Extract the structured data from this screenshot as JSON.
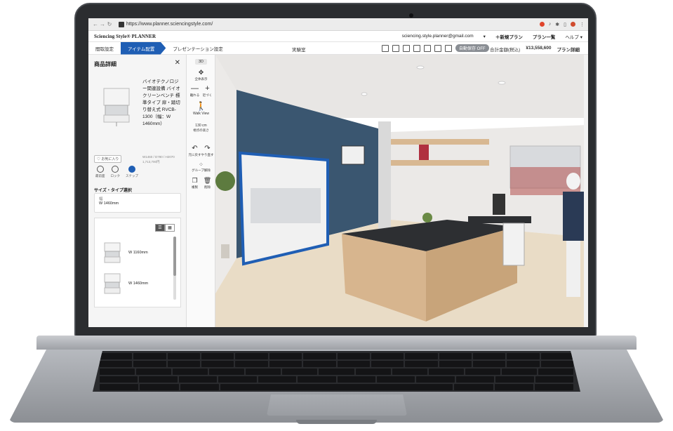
{
  "browser": {
    "url": "https://www.planner.sciencingstyle.com/"
  },
  "header": {
    "logo": "Sciencing Style® PLANNER",
    "email": "sciencing.style.planner@gmail.com",
    "new_plan": "＋新規プラン",
    "plan_list": "プラン一覧",
    "help": "ヘルプ ▾"
  },
  "tabs": {
    "items": [
      "間取設定",
      "アイテム配置",
      "プレゼンテーション設定"
    ],
    "active": "アイテム配置",
    "room_name": "実験室"
  },
  "toolbar_right": {
    "autosave": "自動保存 OFF",
    "total_label": "合計金額(税込)",
    "total_value": "¥13,558,600",
    "plan_detail": "プラン詳細"
  },
  "left_panel": {
    "title": "商品詳細",
    "product_name": "バイオテクノロジー関連設備 バイオクリーンベンチ 標準タイプ 扉・踏切り替え式 RVCB-1300（幅：W 1460mm）",
    "dims": "W1460 / D780 / H2070",
    "price": "1,713,700円",
    "favorite": "♡ お気に入り",
    "actions": [
      "最前面",
      "ロック",
      "スナップ"
    ],
    "size_title": "サイズ・タイプ選択",
    "size_card_label": "幅",
    "size_card_value": "W 1460mm",
    "list_items": [
      "W 1160mm",
      "W 1460mm"
    ]
  },
  "vtoolbar": {
    "mode": "3D",
    "fit": "全体表示",
    "zoom_out": "離れる",
    "zoom_in": "近づく",
    "walk_view": "Walk View",
    "cam_height": "130",
    "cam_unit": "cm",
    "cam_label": "視点の高さ",
    "undo": "元に戻す",
    "redo": "やり直す",
    "group": "グループ解除",
    "copy": "複製",
    "delete": "削除"
  }
}
